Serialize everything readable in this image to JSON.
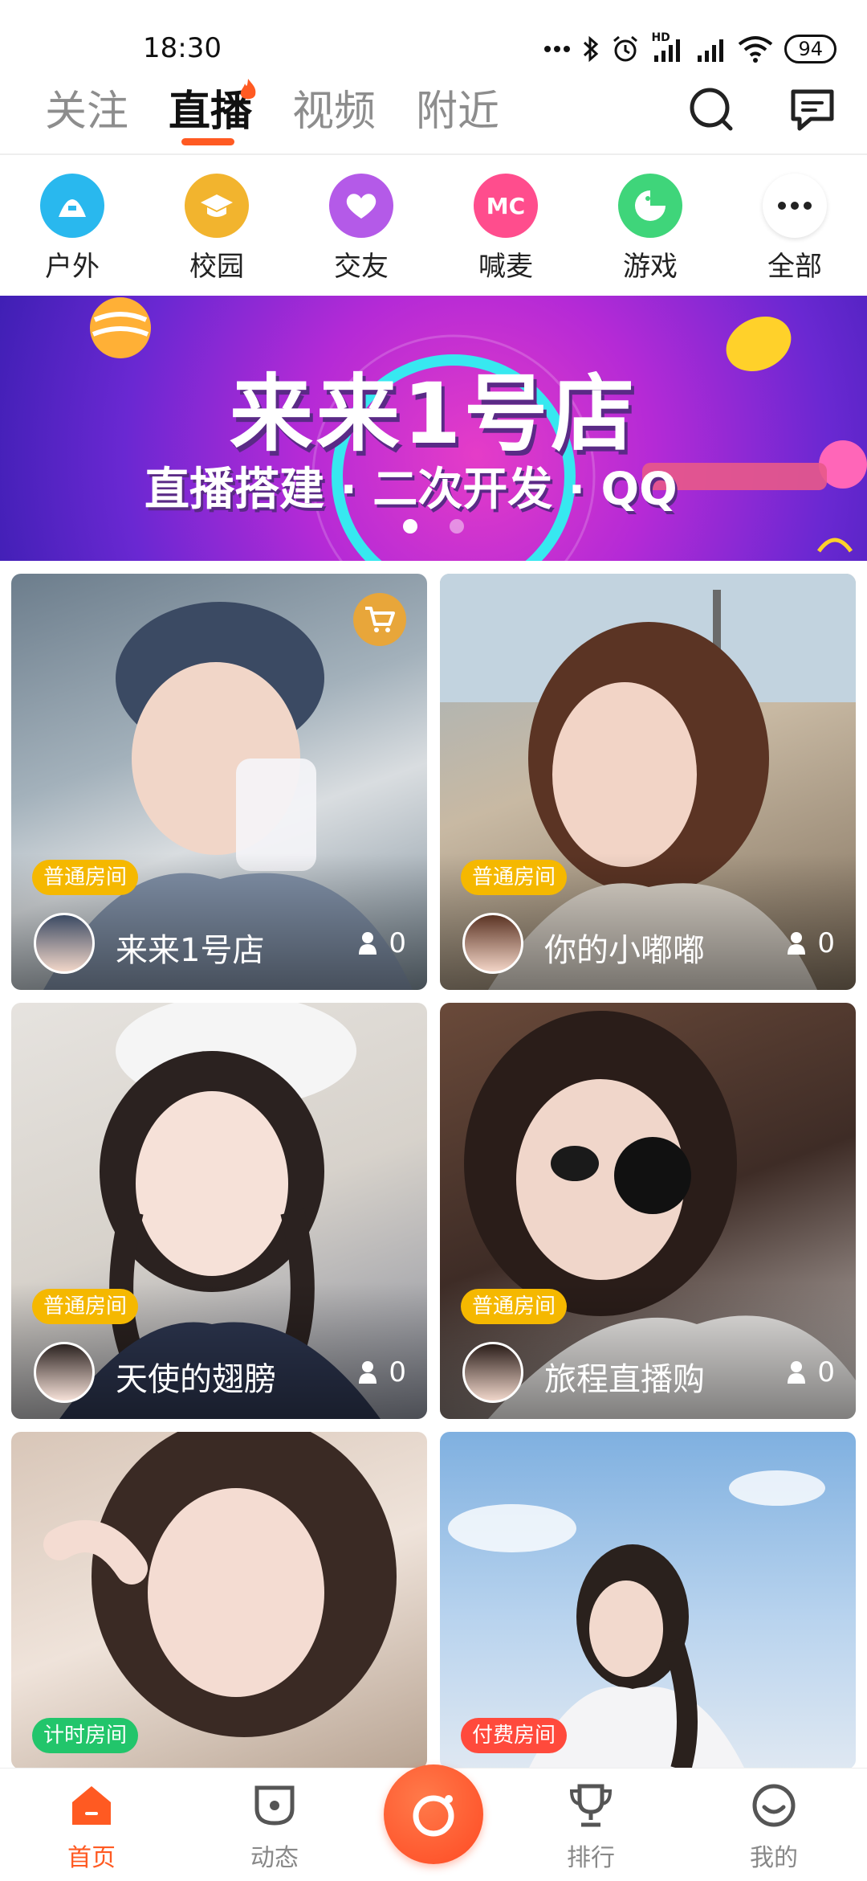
{
  "status_bar": {
    "time": "18:30",
    "battery": "94",
    "network_label": "HD"
  },
  "top_tabs": [
    {
      "label": "关注",
      "active": false
    },
    {
      "label": "直播",
      "active": true
    },
    {
      "label": "视频",
      "active": false
    },
    {
      "label": "附近",
      "active": false
    }
  ],
  "header_icons": {
    "search": "search-icon",
    "message": "message-icon"
  },
  "categories": [
    {
      "label": "户外",
      "icon": "outdoor-icon",
      "color": "#29b8ee"
    },
    {
      "label": "校园",
      "icon": "campus-icon",
      "color": "#f2b42e"
    },
    {
      "label": "交友",
      "icon": "heart-icon",
      "color": "#b45ae8"
    },
    {
      "label": "喊麦",
      "icon": "mc-icon",
      "text": "MC",
      "color": "#ff4d8d"
    },
    {
      "label": "游戏",
      "icon": "game-icon",
      "color": "#3fd57a"
    },
    {
      "label": "全部",
      "icon": "more-icon",
      "color": "#ffffff"
    }
  ],
  "banner": {
    "title": "来来1号店",
    "subtitle": "直播搭建 · 二次开发 · QQ",
    "current_slide": 1,
    "slides": 2
  },
  "rooms": [
    {
      "badge": "普通房间",
      "badge_color": "#f5b800",
      "host": "来来1号店",
      "viewers": "0",
      "cart": true
    },
    {
      "badge": "普通房间",
      "badge_color": "#f5b800",
      "host": "你的小嘟嘟",
      "viewers": "0",
      "cart": false
    },
    {
      "badge": "普通房间",
      "badge_color": "#f5b800",
      "host": "天使的翅膀",
      "viewers": "0",
      "cart": false
    },
    {
      "badge": "普通房间",
      "badge_color": "#f5b800",
      "host": "旅程直播购",
      "viewers": "0",
      "cart": false
    },
    {
      "badge": "计时房间",
      "badge_color": "#22c56b",
      "host": "",
      "viewers": "",
      "cart": false
    },
    {
      "badge": "付费房间",
      "badge_color": "#ff4a3c",
      "host": "",
      "viewers": "",
      "cart": false
    }
  ],
  "bottom_nav": [
    {
      "label": "首页",
      "icon": "home-icon",
      "active": true
    },
    {
      "label": "动态",
      "icon": "feed-icon",
      "active": false
    },
    {
      "label": "排行",
      "icon": "trophy-icon",
      "active": false
    },
    {
      "label": "我的",
      "icon": "profile-icon",
      "active": false
    }
  ],
  "center_button_icon": "camera-live-icon",
  "accent_color": "#ff5a22"
}
